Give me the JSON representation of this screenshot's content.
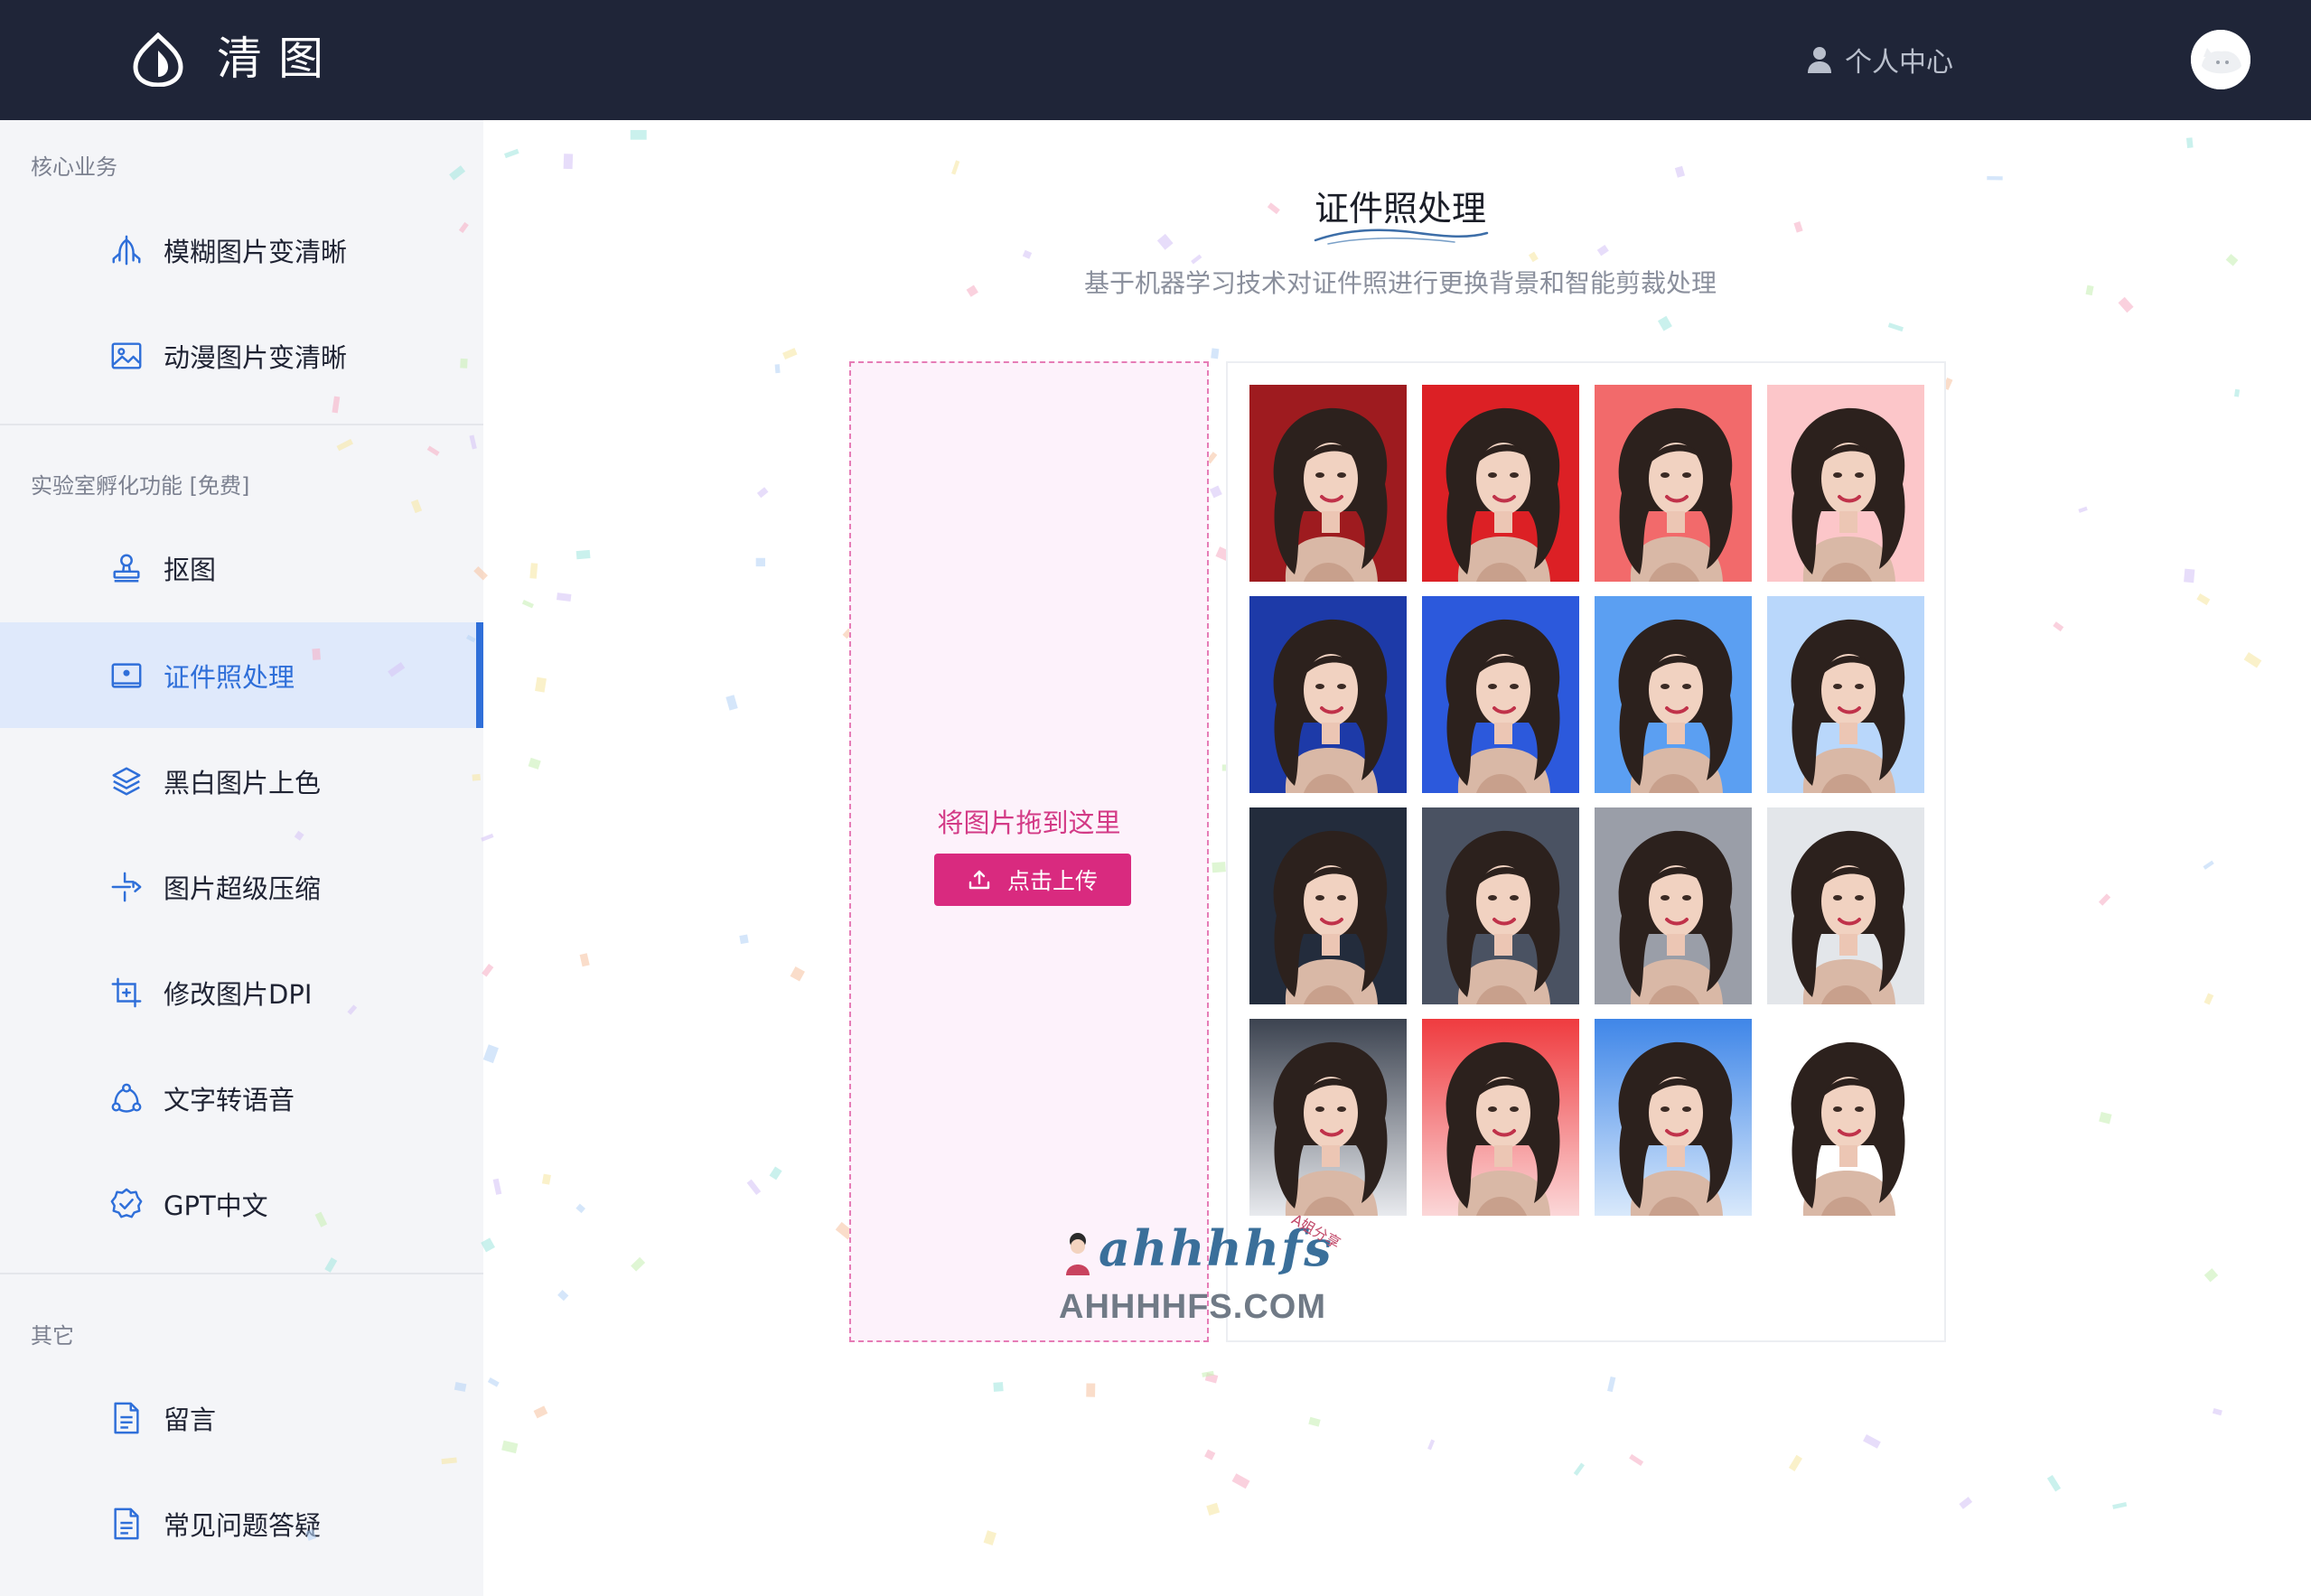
{
  "header": {
    "brand": "清图",
    "user_center": "个人中心"
  },
  "sidebar": {
    "sections": [
      {
        "title": "核心业务",
        "items": [
          {
            "label": "模糊图片变清晰",
            "icon": "clarity-icon"
          },
          {
            "label": "动漫图片变清晰",
            "icon": "image-icon"
          }
        ]
      },
      {
        "title": "实验室孵化功能 [免费]",
        "items": [
          {
            "label": "抠图",
            "icon": "stamp-icon"
          },
          {
            "label": "证件照处理",
            "icon": "id-photo-icon",
            "active": true
          },
          {
            "label": "黑白图片上色",
            "icon": "layers-icon"
          },
          {
            "label": "图片超级压缩",
            "icon": "compress-icon"
          },
          {
            "label": "修改图片DPI",
            "icon": "crop-icon"
          },
          {
            "label": "文字转语音",
            "icon": "voice-icon"
          },
          {
            "label": "GPT中文",
            "icon": "badge-check-icon"
          }
        ]
      },
      {
        "title": "其它",
        "items": [
          {
            "label": "留言",
            "icon": "document-icon"
          },
          {
            "label": "常见问题答疑",
            "icon": "faq-document-icon"
          }
        ]
      }
    ]
  },
  "main": {
    "title": "证件照处理",
    "subtitle": "基于机器学习技术对证件照进行更换背景和智能剪裁处理",
    "dropzone": {
      "hint": "将图片拖到这里",
      "upload_label": "点击上传"
    },
    "sample_backgrounds": [
      "#9e1b1f",
      "#dc2025",
      "#f26a6b",
      "#fcc6c9",
      "#1d3aa8",
      "#2c59dc",
      "#5b9ff2",
      "#b9d7fb",
      "#232c3c",
      "#4a5262",
      "#9a9ea8",
      "#e3e6ea",
      "gradient-gray",
      "gradient-red",
      "gradient-blue",
      "#ffffff"
    ]
  },
  "watermark": {
    "script": "ahhhhfs",
    "tag": "A姐分享",
    "url": "AHHHHFS.COM"
  },
  "colors": {
    "header_bg": "#1f2538",
    "sidebar_bg": "#f4f5f8",
    "accent": "#2f6fd9",
    "upload_button": "#d92a7f"
  }
}
